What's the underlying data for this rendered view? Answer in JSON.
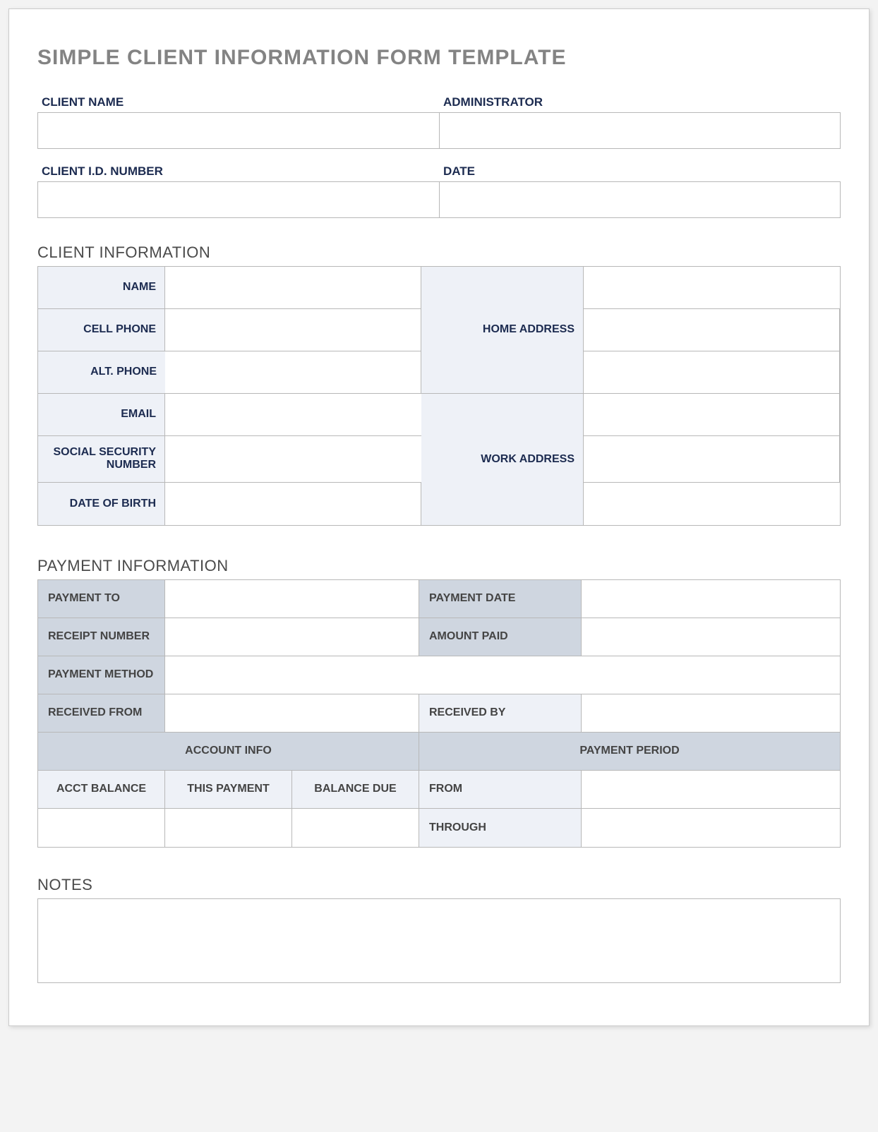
{
  "title": "SIMPLE CLIENT INFORMATION FORM TEMPLATE",
  "top": {
    "client_name_label": "CLIENT NAME",
    "client_name_value": "",
    "administrator_label": "ADMINISTRATOR",
    "administrator_value": "",
    "client_id_label": "CLIENT I.D. NUMBER",
    "client_id_value": "",
    "date_label": "DATE",
    "date_value": ""
  },
  "sections": {
    "client_info": "CLIENT INFORMATION",
    "payment_info": "PAYMENT INFORMATION",
    "notes": "NOTES"
  },
  "client": {
    "name_label": "NAME",
    "name_value": "",
    "cell_phone_label": "CELL PHONE",
    "cell_phone_value": "",
    "alt_phone_label": "ALT. PHONE",
    "alt_phone_value": "",
    "email_label": "EMAIL",
    "email_value": "",
    "ssn_label": "SOCIAL SECURITY NUMBER",
    "ssn_value": "",
    "dob_label": "DATE OF BIRTH",
    "dob_value": "",
    "home_address_label": "HOME ADDRESS",
    "home_address_value_1": "",
    "home_address_value_2": "",
    "home_address_value_3": "",
    "work_address_label": "WORK ADDRESS",
    "work_address_value_1": "",
    "work_address_value_2": "",
    "work_address_value_3": ""
  },
  "payment": {
    "payment_to_label": "PAYMENT TO",
    "payment_to_value": "",
    "payment_date_label": "PAYMENT DATE",
    "payment_date_value": "",
    "receipt_number_label": "RECEIPT NUMBER",
    "receipt_number_value": "",
    "amount_paid_label": "AMOUNT PAID",
    "amount_paid_value": "",
    "payment_method_label": "PAYMENT METHOD",
    "payment_method_value": "",
    "received_from_label": "RECEIVED FROM",
    "received_from_value": "",
    "received_by_label": "RECEIVED BY",
    "received_by_value": "",
    "account_info_label": "ACCOUNT INFO",
    "payment_period_label": "PAYMENT PERIOD",
    "acct_balance_label": "ACCT BALANCE",
    "acct_balance_value": "",
    "this_payment_label": "THIS PAYMENT",
    "this_payment_value": "",
    "balance_due_label": "BALANCE DUE",
    "balance_due_value": "",
    "from_label": "FROM",
    "from_value": "",
    "through_label": "THROUGH",
    "through_value": ""
  },
  "notes_value": ""
}
